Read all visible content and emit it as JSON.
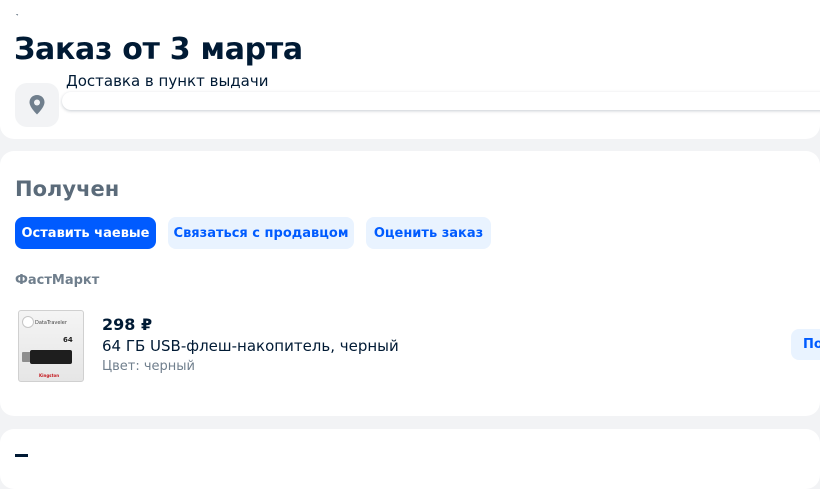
{
  "order": {
    "title": "Заказ от 3 марта",
    "delivery_label": "Доставка в пункт выдачи",
    "status": "Получен"
  },
  "actions": {
    "tip": "Оставить чаевые",
    "contact": "Связаться с продавцом",
    "rate": "Оценить заказ"
  },
  "seller": {
    "name": "ФастМаркт"
  },
  "item": {
    "price": "298 ₽",
    "name": "64 ГБ USB-флеш-накопитель, черный",
    "color": "Цвет: черный",
    "action_label": "По",
    "thumbnail_icon": "usb-flash-drive-package-image",
    "thumbnail_size_label": "64",
    "thumbnail_brand": "Kingston"
  },
  "icons": {
    "location": "map-pin-icon"
  },
  "colors": {
    "accent": "#005bff",
    "accent_light": "#e9f3ff",
    "text_primary": "#001a34",
    "text_secondary": "#707f8d",
    "status": "#5b6b7a",
    "background": "#f2f3f5"
  }
}
